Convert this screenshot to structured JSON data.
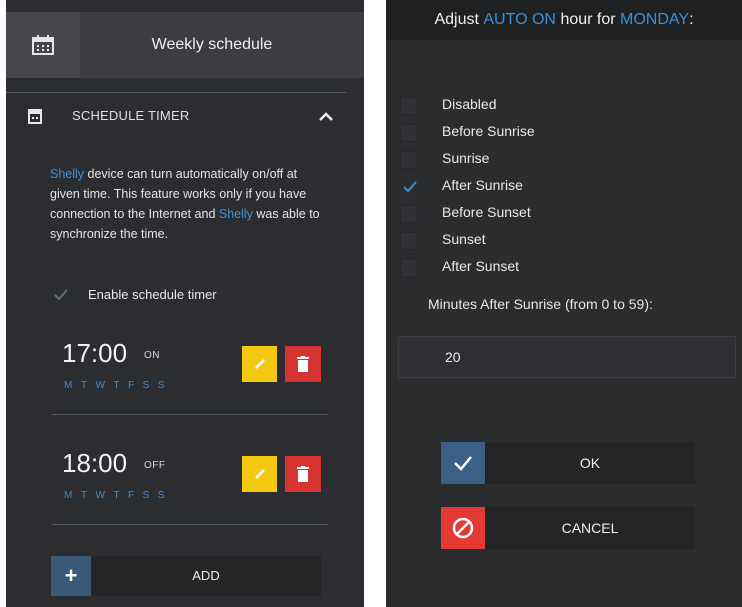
{
  "colors": {
    "panel_bg": "#2b2d30",
    "accent_blue": "#3d8fd8",
    "edit_yellow": "#f2c811",
    "delete_red": "#d53430",
    "cancel_red": "#e53935",
    "ok_blue": "#3b5f86"
  },
  "left": {
    "header": {
      "title": "Weekly schedule",
      "icon": "calendar-grid-icon"
    },
    "section": {
      "title": "SCHEDULE TIMER",
      "icon": "calendar-icon",
      "toggle_icon": "chevron-up-icon"
    },
    "description": {
      "part1": "Shelly",
      "part2": " device can turn automatically on/off at given time. This feature works only if you have connection to the Internet and ",
      "part3": "Shelly",
      "part4": " was able to synchronize the time."
    },
    "enable": {
      "label": "Enable schedule timer",
      "checked": true
    },
    "timers": [
      {
        "time": "17:00",
        "state": "ON",
        "days": [
          "M",
          "T",
          "W",
          "T",
          "F",
          "S",
          "S"
        ]
      },
      {
        "time": "18:00",
        "state": "OFF",
        "days": [
          "M",
          "T",
          "W",
          "T",
          "F",
          "S",
          "S"
        ]
      }
    ],
    "add_button": {
      "icon_label": "+",
      "label": "ADD"
    }
  },
  "right": {
    "title": {
      "prefix": "Adjust ",
      "mode": "AUTO ON",
      "middle": " hour for ",
      "day": "MONDAY",
      "suffix": ":"
    },
    "options": [
      {
        "label": "Disabled",
        "checked": false
      },
      {
        "label": "Before Sunrise",
        "checked": false
      },
      {
        "label": "Sunrise",
        "checked": false
      },
      {
        "label": "After Sunrise",
        "checked": true
      },
      {
        "label": "Before Sunset",
        "checked": false
      },
      {
        "label": "Sunset",
        "checked": false
      },
      {
        "label": "After Sunset",
        "checked": false
      }
    ],
    "minutes_label": "Minutes After Sunrise (from 0 to 59):",
    "minutes_value": "20",
    "ok_label": "OK",
    "cancel_label": "CANCEL"
  }
}
